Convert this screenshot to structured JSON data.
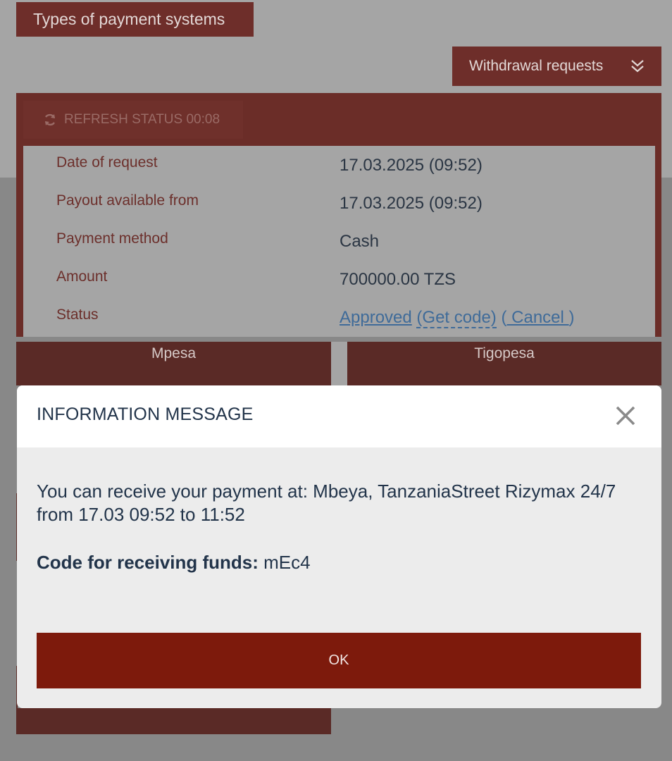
{
  "header": {
    "types_label": "Types of payment systems",
    "withdrawal_label": "Withdrawal requests"
  },
  "panel": {
    "refresh_label": "REFRESH STATUS 00:08",
    "rows": [
      {
        "label": "Date of request",
        "value": "17.03.2025 (09:52)"
      },
      {
        "label": "Payout available from",
        "value": "17.03.2025 (09:52)"
      },
      {
        "label": "Payment method",
        "value": "Cash"
      },
      {
        "label": "Amount",
        "value": "700000.00 TZS"
      },
      {
        "label": "Status"
      }
    ],
    "status": {
      "approved": "Approved",
      "get_code": "(Get code)",
      "open_paren": "(",
      "cancel": " Cancel ",
      "close_paren": ")"
    }
  },
  "tabs": {
    "left": "Mpesa",
    "right": "Tigopesa"
  },
  "modal": {
    "title": "INFORMATION MESSAGE",
    "message": "You can receive your payment at: Mbeya, TanzaniaStreet Rizymax 24/7 from 17.03 09:52 to 11:52",
    "code_label": "Code for receiving funds:",
    "code_value": " mEc4",
    "ok_label": "OK"
  },
  "colors": {
    "brand": "#6e2e2a",
    "ok_button": "#7d1a0c",
    "link": "#3f6b99"
  },
  "icons": {
    "refresh": "refresh-icon",
    "chevron": "double-chevron-down-icon",
    "close": "close-icon"
  }
}
